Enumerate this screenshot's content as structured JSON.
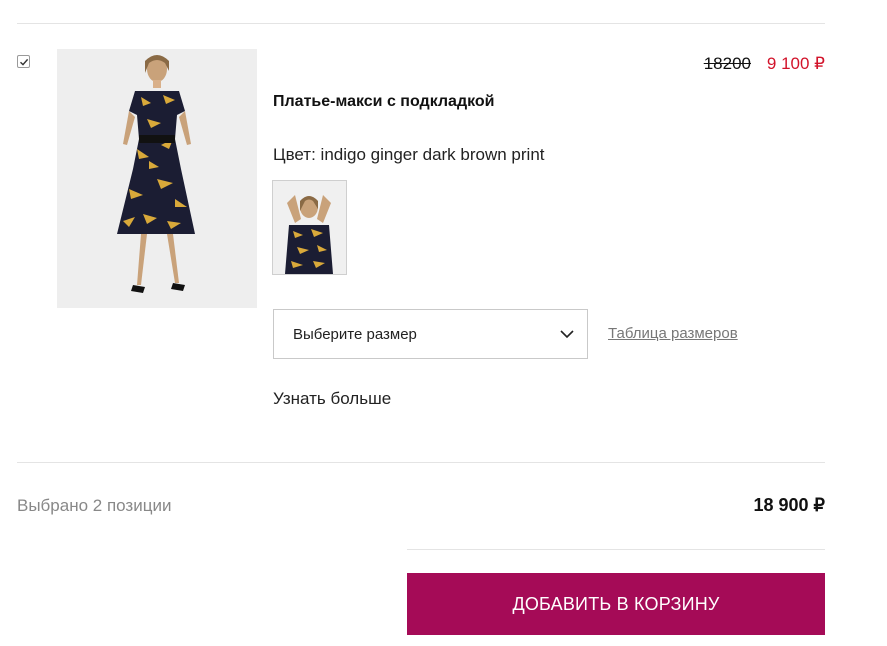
{
  "product": {
    "checked": true,
    "price_old": "18200",
    "price_new": "9 100 ₽",
    "title": "Платье-макси с подкладкой",
    "color_label": "Цвет: indigo ginger dark brown print",
    "image_icon": "dress-photo",
    "thumb_icon": "color-swatch-photo",
    "size_select": {
      "value": "Выберите размер"
    },
    "size_table_link": "Таблица размеров",
    "more_link": "Узнать больше"
  },
  "summary": {
    "selected_text": "Выбрано 2 позиции",
    "total": "18 900 ₽",
    "add_to_cart": "ДОБАВИТЬ В КОРЗИНУ"
  },
  "colors": {
    "accent": "#a50b57",
    "sale": "#d2132a"
  }
}
